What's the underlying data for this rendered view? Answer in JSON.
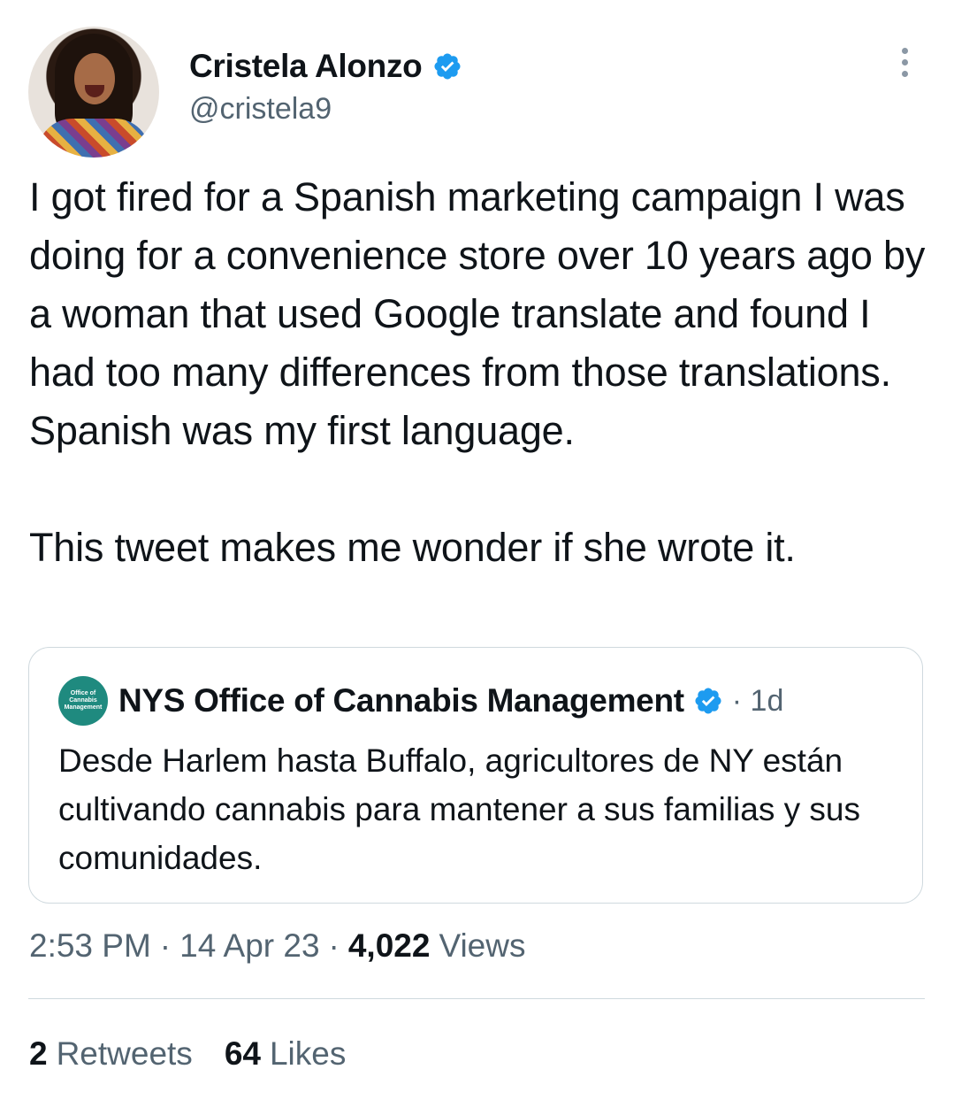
{
  "author": {
    "name": "Cristela Alonzo",
    "handle": "@cristela9",
    "verified": true
  },
  "tweet": {
    "paragraphs": [
      "I got fired for a Spanish marketing campaign I was doing for a convenience store over 10 years ago by a woman that used Google translate and found I had too many differences from those translations. Spanish was my first language.",
      "This tweet makes me wonder if she wrote it."
    ]
  },
  "quoted_tweet": {
    "avatar_text": [
      "Office of",
      "Cannabis",
      "Management"
    ],
    "name": "NYS Office of Cannabis Management",
    "time": "· 1d",
    "text": "Desde Harlem hasta Buffalo, agricultores de NY están cultivando cannabis para mantener a sus familias y sus comunidades."
  },
  "meta": {
    "time": "2:53 PM",
    "separator": "·",
    "date": "14 Apr 23",
    "views_count": "4,022",
    "views_label": "Views"
  },
  "stats": {
    "retweets_count": "2",
    "retweets_label": "Retweets",
    "likes_count": "64",
    "likes_label": "Likes"
  },
  "colors": {
    "verified_blue": "#1d9bf0",
    "secondary_text": "#536471",
    "border": "#cfd9de",
    "org_avatar": "#1f8a7f"
  }
}
